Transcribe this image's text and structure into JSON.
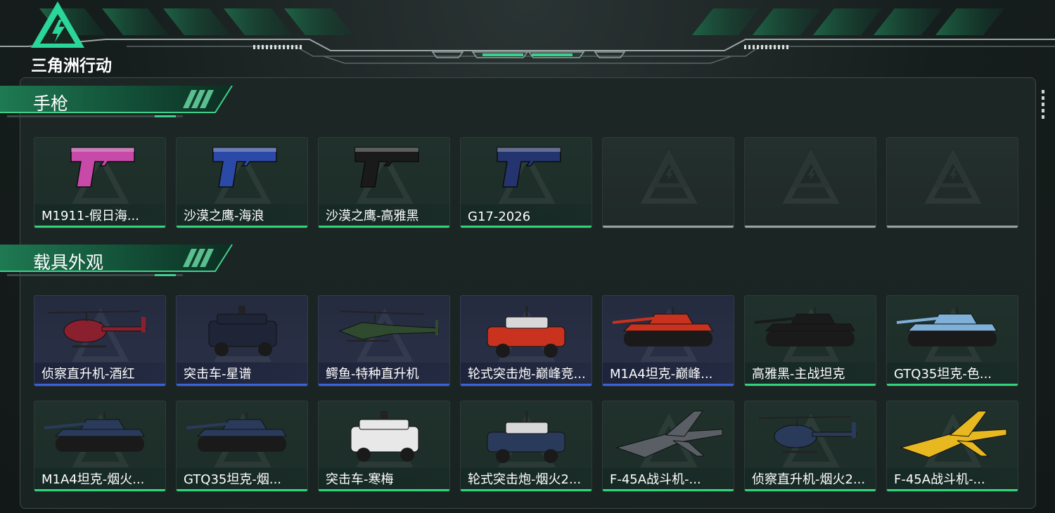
{
  "app": {
    "logo_text": "三角洲行动",
    "accent_green": "#34d27a",
    "accent_blue": "#3a63d8",
    "empty_gray": "#9aa3a1"
  },
  "sections": [
    {
      "title": "手枪",
      "items": [
        {
          "label": "M1911-假日海...",
          "rarity": "green",
          "icon": "pistol-icon",
          "color": "#c84aa8"
        },
        {
          "label": "沙漠之鹰-海浪",
          "rarity": "green",
          "icon": "pistol-icon",
          "color": "#2b4aa8"
        },
        {
          "label": "沙漠之鹰-高雅黑",
          "rarity": "green",
          "icon": "pistol-icon",
          "color": "#1a1a1a"
        },
        {
          "label": "G17-2026",
          "rarity": "green",
          "icon": "pistol-icon",
          "color": "#24346e"
        },
        {
          "label": "",
          "rarity": "empty",
          "icon": "empty-slot-icon"
        },
        {
          "label": "",
          "rarity": "empty",
          "icon": "empty-slot-icon"
        },
        {
          "label": "",
          "rarity": "empty",
          "icon": "empty-slot-icon"
        }
      ]
    },
    {
      "title": "载具外观",
      "rows": [
        [
          {
            "label": "侦察直升机-酒红",
            "rarity": "blue",
            "icon": "helicopter-icon",
            "color": "#8a1f2e"
          },
          {
            "label": "突击车-星谱",
            "rarity": "blue",
            "icon": "armored-car-icon",
            "color": "#1e2536"
          },
          {
            "label": "鳄鱼-特种直升机",
            "rarity": "blue",
            "icon": "attack-helicopter-icon",
            "color": "#2f4a2f"
          },
          {
            "label": "轮式突击炮-巅峰竞...",
            "rarity": "blue",
            "icon": "wheeled-assault-gun-icon",
            "color": "#c8321e"
          },
          {
            "label": "M1A4坦克-巅峰...",
            "rarity": "blue",
            "icon": "tank-icon",
            "color": "#c8321e"
          },
          {
            "label": "高雅黑-主战坦克",
            "rarity": "green",
            "icon": "tank-icon",
            "color": "#1a1a1a"
          },
          {
            "label": "GTQ35坦克-色...",
            "rarity": "green",
            "icon": "tank-icon",
            "color": "#7fb0d8"
          }
        ],
        [
          {
            "label": "M1A4坦克-烟火...",
            "rarity": "green",
            "icon": "tank-icon",
            "color": "#2a3a5a"
          },
          {
            "label": "GTQ35坦克-烟...",
            "rarity": "green",
            "icon": "tank-icon",
            "color": "#2a3a5a"
          },
          {
            "label": "突击车-寒梅",
            "rarity": "green",
            "icon": "armored-car-icon",
            "color": "#e8e8e8"
          },
          {
            "label": "轮式突击炮-烟火2...",
            "rarity": "green",
            "icon": "wheeled-assault-gun-icon",
            "color": "#2a3a5a"
          },
          {
            "label": "F-45A战斗机-...",
            "rarity": "green",
            "icon": "fighter-jet-icon",
            "color": "#5a5f66"
          },
          {
            "label": "侦察直升机-烟火2...",
            "rarity": "green",
            "icon": "helicopter-icon",
            "color": "#2a3a5a"
          },
          {
            "label": "F-45A战斗机-...",
            "rarity": "green",
            "icon": "fighter-jet-icon",
            "color": "#e8b820"
          }
        ]
      ]
    }
  ]
}
